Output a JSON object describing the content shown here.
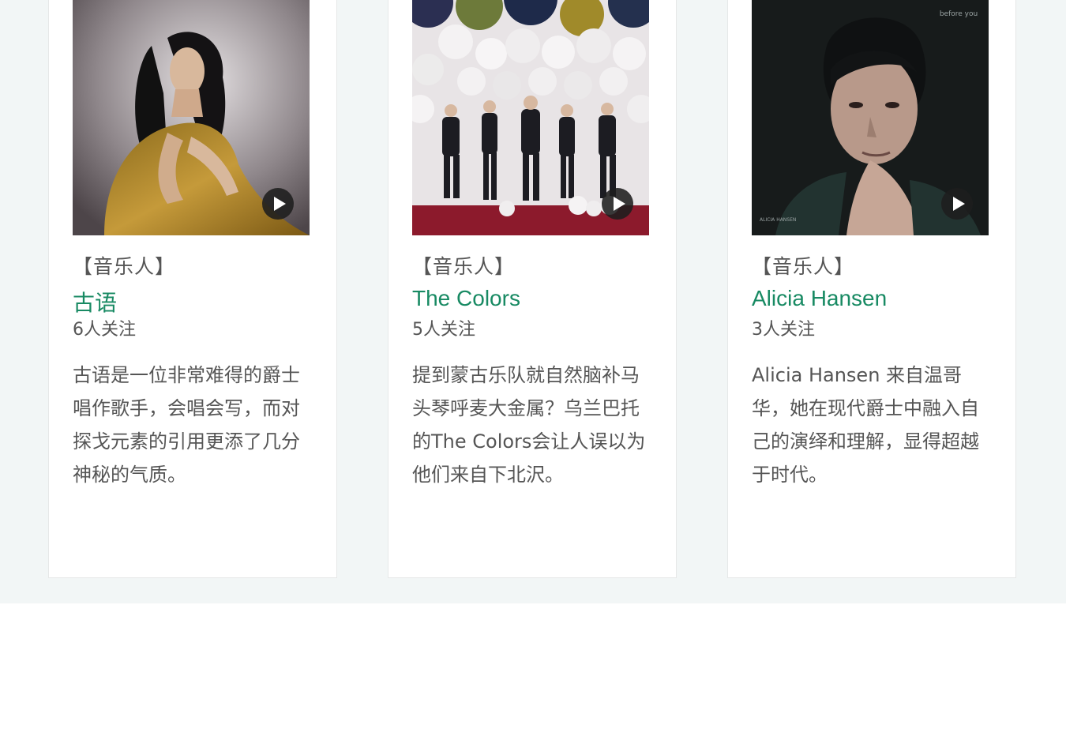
{
  "cards": [
    {
      "tag": "【音乐人】",
      "name": "古语",
      "followers": "6人关注",
      "description": "古语是一位非常难得的爵士唱作歌手，会唱会写，而对探戈元素的引用更添了几分神秘的气质。",
      "photo_icon": "artist-portrait-photo",
      "play_icon": "play-icon"
    },
    {
      "tag": "【音乐人】",
      "name": "The Colors",
      "followers": "5人关注",
      "description": "提到蒙古乐队就自然脑补马头琴呼麦大金属？乌兰巴托的The Colors会让人误以为他们来自下北沢。",
      "photo_icon": "band-with-balloons-photo",
      "play_icon": "play-icon"
    },
    {
      "tag": "【音乐人】",
      "name": "Alicia Hansen",
      "followers": "3人关注",
      "description": "Alicia Hansen 来自温哥华，她在现代爵士中融入自己的演绎和理解，显得超越于时代。",
      "photo_icon": "album-cover-photo",
      "album_cover_text": {
        "title": "before you",
        "artist": "ALICIA HANSEN"
      },
      "play_icon": "play-icon"
    }
  ],
  "colors": {
    "band_background": "#f2f6f6",
    "name_link": "#188a63",
    "body_text": "#555555"
  }
}
